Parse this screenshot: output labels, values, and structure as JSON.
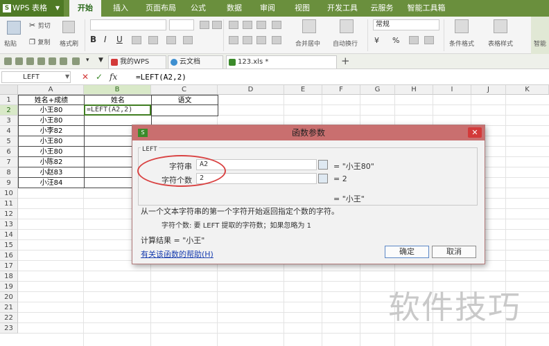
{
  "menubar": {
    "app_name": "WPS 表格",
    "tabs": [
      "开始",
      "插入",
      "页面布局",
      "公式",
      "数据",
      "审阅",
      "视图",
      "开发工具",
      "云服务",
      "智能工具箱"
    ],
    "active_tab": "开始"
  },
  "ribbon": {
    "paste": "粘贴",
    "cut": "剪切",
    "copy": "复制",
    "format_painter": "格式刷",
    "bold": "B",
    "italic": "I",
    "underline": "U",
    "merge_center": "合并居中",
    "auto_wrap": "自动换行",
    "number_format": "常规",
    "conditional_format": "条件格式",
    "table_style": "表格样式",
    "smart": "智能",
    "currency": "¥",
    "percent": "%"
  },
  "doctabs": [
    "我的WPS",
    "云文档",
    "123.xls *"
  ],
  "formula_bar": {
    "name_box": "LEFT",
    "cancel": "✕",
    "confirm": "✓",
    "fx": "fx",
    "formula": "=LEFT(A2,2)"
  },
  "grid": {
    "columns": [
      "A",
      "B",
      "C",
      "D",
      "E",
      "F",
      "G",
      "H",
      "I",
      "J",
      "K"
    ],
    "rows": [
      "1",
      "2",
      "3",
      "4",
      "5",
      "6",
      "7",
      "8",
      "9",
      "10",
      "11",
      "12",
      "13",
      "14",
      "15",
      "16",
      "17",
      "18",
      "19",
      "20",
      "21",
      "22",
      "23"
    ],
    "headers": [
      "姓名+成绩",
      "姓名",
      "语文"
    ],
    "col_a": [
      "小王80",
      "小王80",
      "小李82",
      "小王80",
      "小王80",
      "小陈82",
      "小赵83",
      "小汪84"
    ],
    "active_cell_content": "=LEFT(A2,2)"
  },
  "dialog": {
    "title": "函数参数",
    "function": "LEFT",
    "arg1_label": "字符串",
    "arg1_value": "A2",
    "arg1_result": "= \"小王80\"",
    "arg2_label": "字符个数",
    "arg2_value": "2",
    "arg2_result": "= 2",
    "func_result": "= \"小王\"",
    "description": "从一个文本字符串的第一个字符开始返回指定个数的字符。",
    "arg_description": "字符个数:  要 LEFT 提取的字符数；如果忽略为 1",
    "calc_result": "计算结果 = \"小王\"",
    "help_link": "有关该函数的帮助(H)",
    "ok": "确定",
    "cancel": "取消"
  },
  "watermark": "软件技巧"
}
